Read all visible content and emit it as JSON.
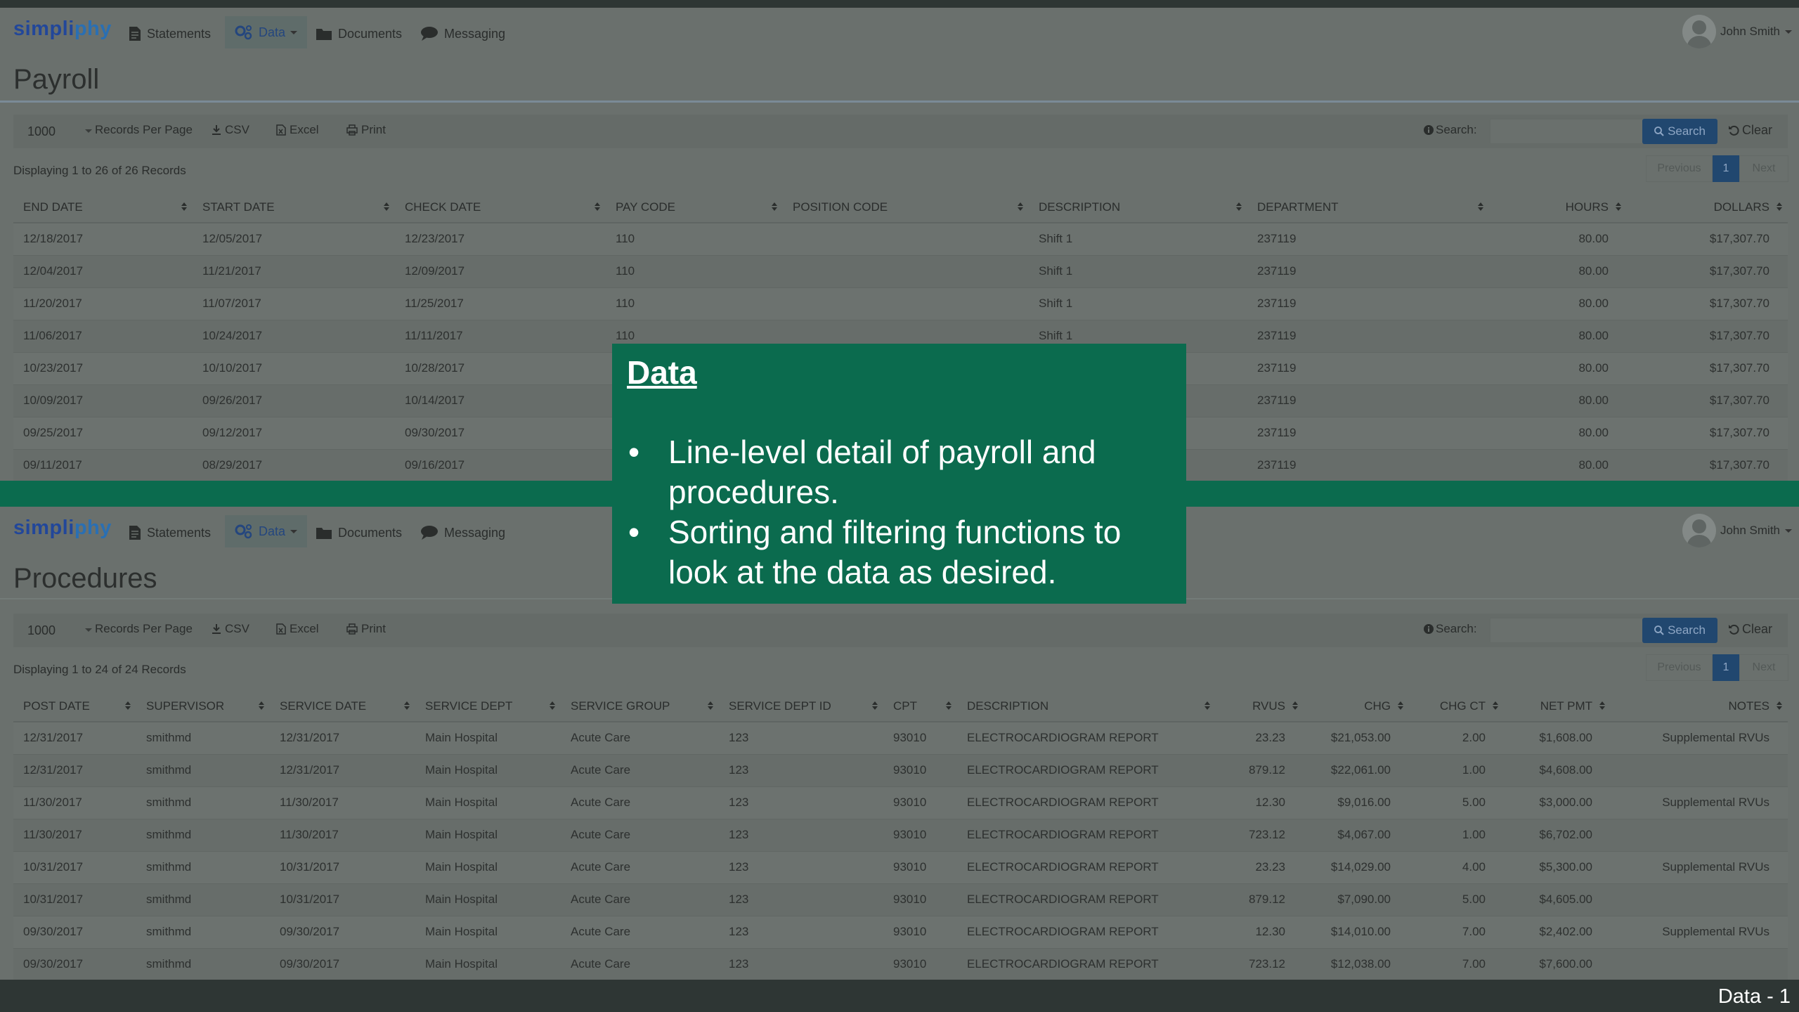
{
  "brand": {
    "left": "simpli",
    "hl": "phy"
  },
  "nav": {
    "statements": "Statements",
    "data": "Data",
    "documents": "Documents",
    "messaging": "Messaging",
    "user": "John Smith"
  },
  "toolbar": {
    "page_size": "1000",
    "records_per_page": "Records Per Page",
    "csv": "CSV",
    "excel": "Excel",
    "print": "Print",
    "search_label": "Search:",
    "search_button": "Search",
    "clear_button": "Clear",
    "previous": "Previous",
    "current_page": "1",
    "next": "Next"
  },
  "payroll": {
    "title": "Payroll",
    "record_count": "Displaying 1 to 26 of 26 Records",
    "columns": [
      "END DATE",
      "START DATE",
      "CHECK DATE",
      "PAY CODE",
      "POSITION CODE",
      "DESCRIPTION",
      "DEPARTMENT",
      "HOURS",
      "DOLLARS"
    ],
    "rows": [
      [
        "12/18/2017",
        "12/05/2017",
        "12/23/2017",
        "110",
        "",
        "Shift 1",
        "237119",
        "80.00",
        "$17,307.70"
      ],
      [
        "12/04/2017",
        "11/21/2017",
        "12/09/2017",
        "110",
        "",
        "Shift 1",
        "237119",
        "80.00",
        "$17,307.70"
      ],
      [
        "11/20/2017",
        "11/07/2017",
        "11/25/2017",
        "110",
        "",
        "Shift 1",
        "237119",
        "80.00",
        "$17,307.70"
      ],
      [
        "11/06/2017",
        "10/24/2017",
        "11/11/2017",
        "110",
        "",
        "Shift 1",
        "237119",
        "80.00",
        "$17,307.70"
      ],
      [
        "10/23/2017",
        "10/10/2017",
        "10/28/2017",
        "",
        "",
        "",
        "237119",
        "80.00",
        "$17,307.70"
      ],
      [
        "10/09/2017",
        "09/26/2017",
        "10/14/2017",
        "",
        "",
        "",
        "237119",
        "80.00",
        "$17,307.70"
      ],
      [
        "09/25/2017",
        "09/12/2017",
        "09/30/2017",
        "",
        "",
        "",
        "237119",
        "80.00",
        "$17,307.70"
      ],
      [
        "09/11/2017",
        "08/29/2017",
        "09/16/2017",
        "",
        "",
        "",
        "237119",
        "80.00",
        "$17,307.70"
      ]
    ]
  },
  "procedures": {
    "title": "Procedures",
    "record_count": "Displaying 1 to 24 of 24 Records",
    "columns": [
      "POST DATE",
      "SUPERVISOR",
      "SERVICE DATE",
      "SERVICE DEPT",
      "SERVICE GROUP",
      "SERVICE DEPT ID",
      "CPT",
      "DESCRIPTION",
      "RVUS",
      "CHG",
      "CHG CT",
      "NET PMT",
      "NOTES"
    ],
    "rows": [
      [
        "12/31/2017",
        "smithmd",
        "12/31/2017",
        "Main Hospital",
        "Acute Care",
        "123",
        "93010",
        "ELECTROCARDIOGRAM REPORT",
        "23.23",
        "$21,053.00",
        "2.00",
        "$1,608.00",
        "Supplemental RVUs"
      ],
      [
        "12/31/2017",
        "smithmd",
        "12/31/2017",
        "Main Hospital",
        "Acute Care",
        "123",
        "93010",
        "ELECTROCARDIOGRAM REPORT",
        "879.12",
        "$22,061.00",
        "1.00",
        "$4,608.00",
        ""
      ],
      [
        "11/30/2017",
        "smithmd",
        "11/30/2017",
        "Main Hospital",
        "Acute Care",
        "123",
        "93010",
        "ELECTROCARDIOGRAM REPORT",
        "12.30",
        "$9,016.00",
        "5.00",
        "$3,000.00",
        "Supplemental RVUs"
      ],
      [
        "11/30/2017",
        "smithmd",
        "11/30/2017",
        "Main Hospital",
        "Acute Care",
        "123",
        "93010",
        "ELECTROCARDIOGRAM REPORT",
        "723.12",
        "$4,067.00",
        "1.00",
        "$6,702.00",
        ""
      ],
      [
        "10/31/2017",
        "smithmd",
        "10/31/2017",
        "Main Hospital",
        "Acute Care",
        "123",
        "93010",
        "ELECTROCARDIOGRAM REPORT",
        "23.23",
        "$14,029.00",
        "4.00",
        "$5,300.00",
        "Supplemental RVUs"
      ],
      [
        "10/31/2017",
        "smithmd",
        "10/31/2017",
        "Main Hospital",
        "Acute Care",
        "123",
        "93010",
        "ELECTROCARDIOGRAM REPORT",
        "879.12",
        "$7,090.00",
        "5.00",
        "$4,605.00",
        ""
      ],
      [
        "09/30/2017",
        "smithmd",
        "09/30/2017",
        "Main Hospital",
        "Acute Care",
        "123",
        "93010",
        "ELECTROCARDIOGRAM REPORT",
        "12.30",
        "$14,010.00",
        "7.00",
        "$2,402.00",
        "Supplemental RVUs"
      ],
      [
        "09/30/2017",
        "smithmd",
        "09/30/2017",
        "Main Hospital",
        "Acute Care",
        "123",
        "93010",
        "ELECTROCARDIOGRAM REPORT",
        "723.12",
        "$12,038.00",
        "7.00",
        "$7,600.00",
        ""
      ]
    ]
  },
  "callout": {
    "title": "Data",
    "bullets": [
      "Line-level detail of payroll and procedures.",
      "Sorting and filtering functions to look at the data as desired."
    ]
  },
  "footer": {
    "label": "Data - 1"
  },
  "colors": {
    "overlay_green": "#0b6b4e",
    "brand_blue": "#22479a",
    "button_blue": "#21476f"
  }
}
